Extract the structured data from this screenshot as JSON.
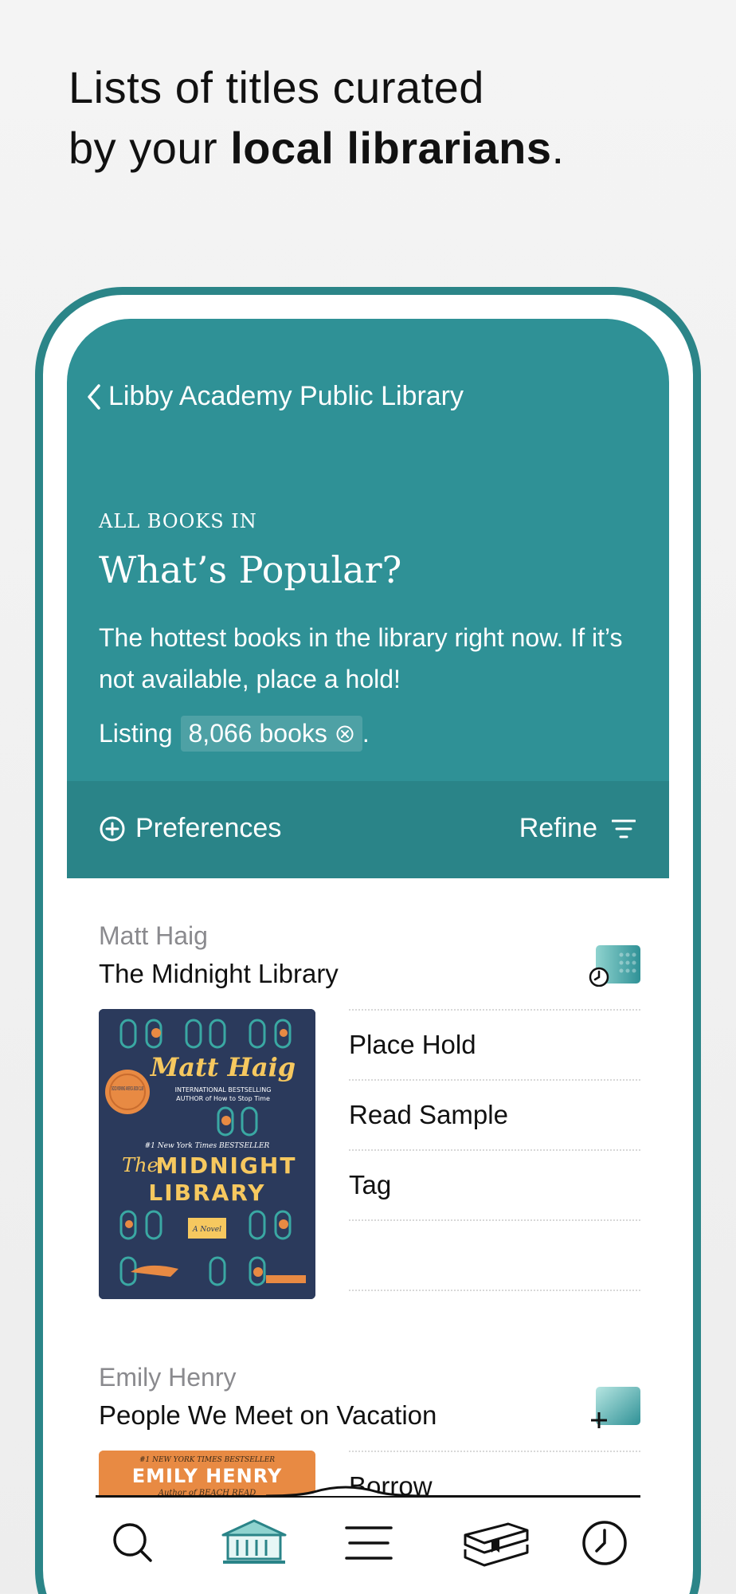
{
  "headline": {
    "line1": "Lists of titles curated",
    "line2_prefix": "by your ",
    "line2_bold": "local librarians",
    "line2_suffix": "."
  },
  "nav": {
    "back_label": "Libby Academy Public Library"
  },
  "list": {
    "eyebrow": "ALL BOOKS IN",
    "title": "What’s Popular?",
    "description": "The hottest books in the library right now. If it’s not available, place a hold!",
    "listing_prefix": "Listing",
    "count": "8,066 books",
    "listing_suffix": "."
  },
  "toolbar": {
    "preferences_label": "Preferences",
    "refine_label": "Refine"
  },
  "books": [
    {
      "author": "Matt Haig",
      "title": "The Midnight Library",
      "actions": [
        "Place Hold",
        "Read Sample",
        "Tag"
      ],
      "cover": {
        "author": "Matt Haig",
        "blurb1": "INTERNATIONAL BESTSELLING",
        "blurb2": "AUTHOR of How to Stop Time",
        "tagline": "#1 New York Times BESTSELLER",
        "title_the": "The",
        "title_line1": "MIDNIGHT",
        "title_line2": "LIBRARY",
        "novel": "A Novel",
        "badge": "GOOD MORNING AMERICA BOOK CLUB"
      }
    },
    {
      "author": "Emily Henry",
      "title": "People We Meet on Vacation",
      "actions": [
        "Borrow"
      ],
      "cover": {
        "tagline": "#1 NEW YORK TIMES BESTSELLER",
        "author": "EMILY HENRY",
        "sub": "Author of BEACH READ"
      }
    }
  ],
  "tabs": [
    "search-tab",
    "library-tab",
    "menu-tab",
    "shelf-tab",
    "timeline-tab"
  ],
  "colors": {
    "teal": "#2f9196",
    "teal_dark": "#2a8488",
    "frame": "#2b8588",
    "cover_navy": "#2b3a5c",
    "cover_orange": "#e88a43"
  }
}
